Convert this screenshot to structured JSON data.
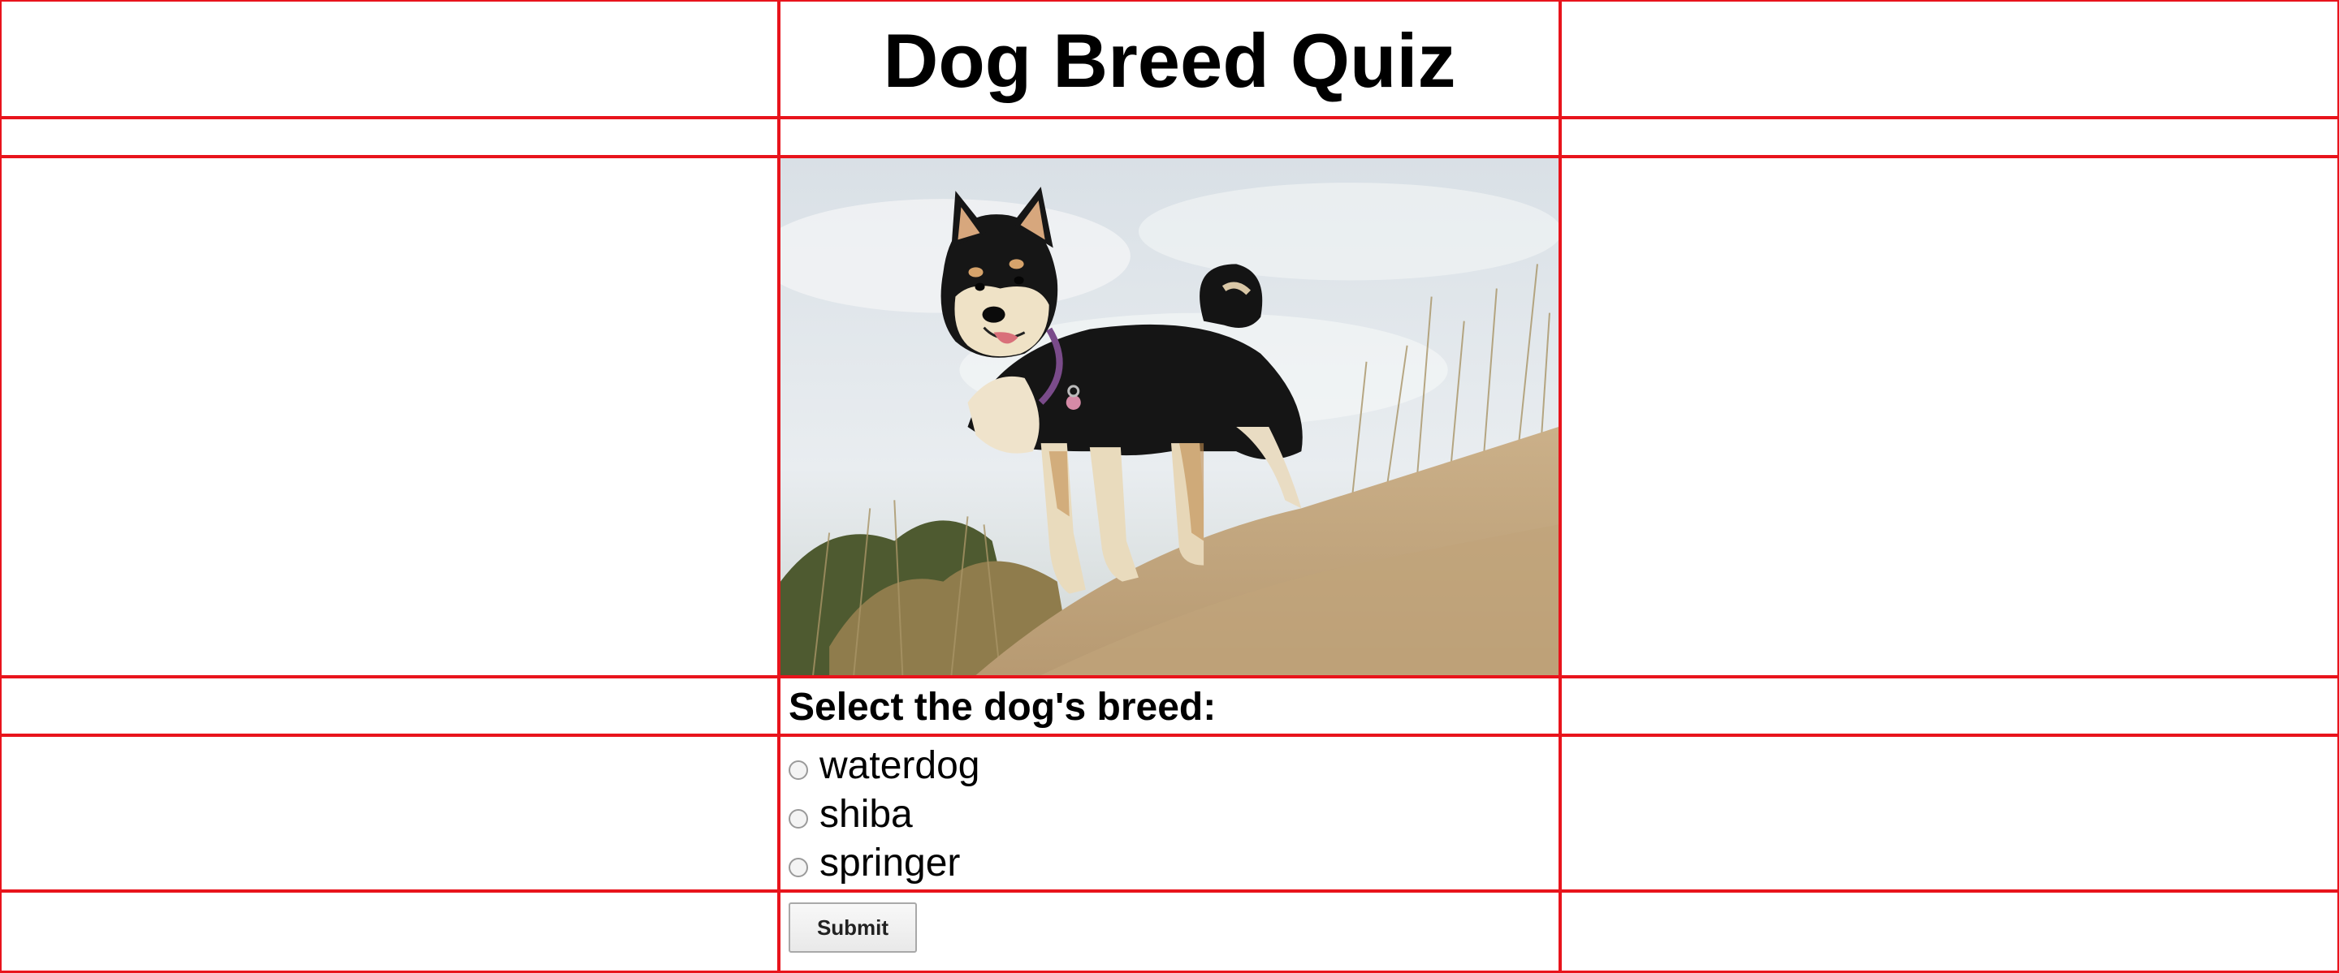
{
  "page": {
    "title": "Dog Breed Quiz"
  },
  "quiz": {
    "image_alt": "shiba-dog-photo",
    "question": "Select the dog's breed:",
    "options": [
      {
        "label": "waterdog",
        "selected": false
      },
      {
        "label": "shiba",
        "selected": false
      },
      {
        "label": "springer",
        "selected": false
      }
    ],
    "submit_label": "Submit"
  },
  "colors": {
    "grid_border": "#e8141c",
    "text": "#000000"
  }
}
